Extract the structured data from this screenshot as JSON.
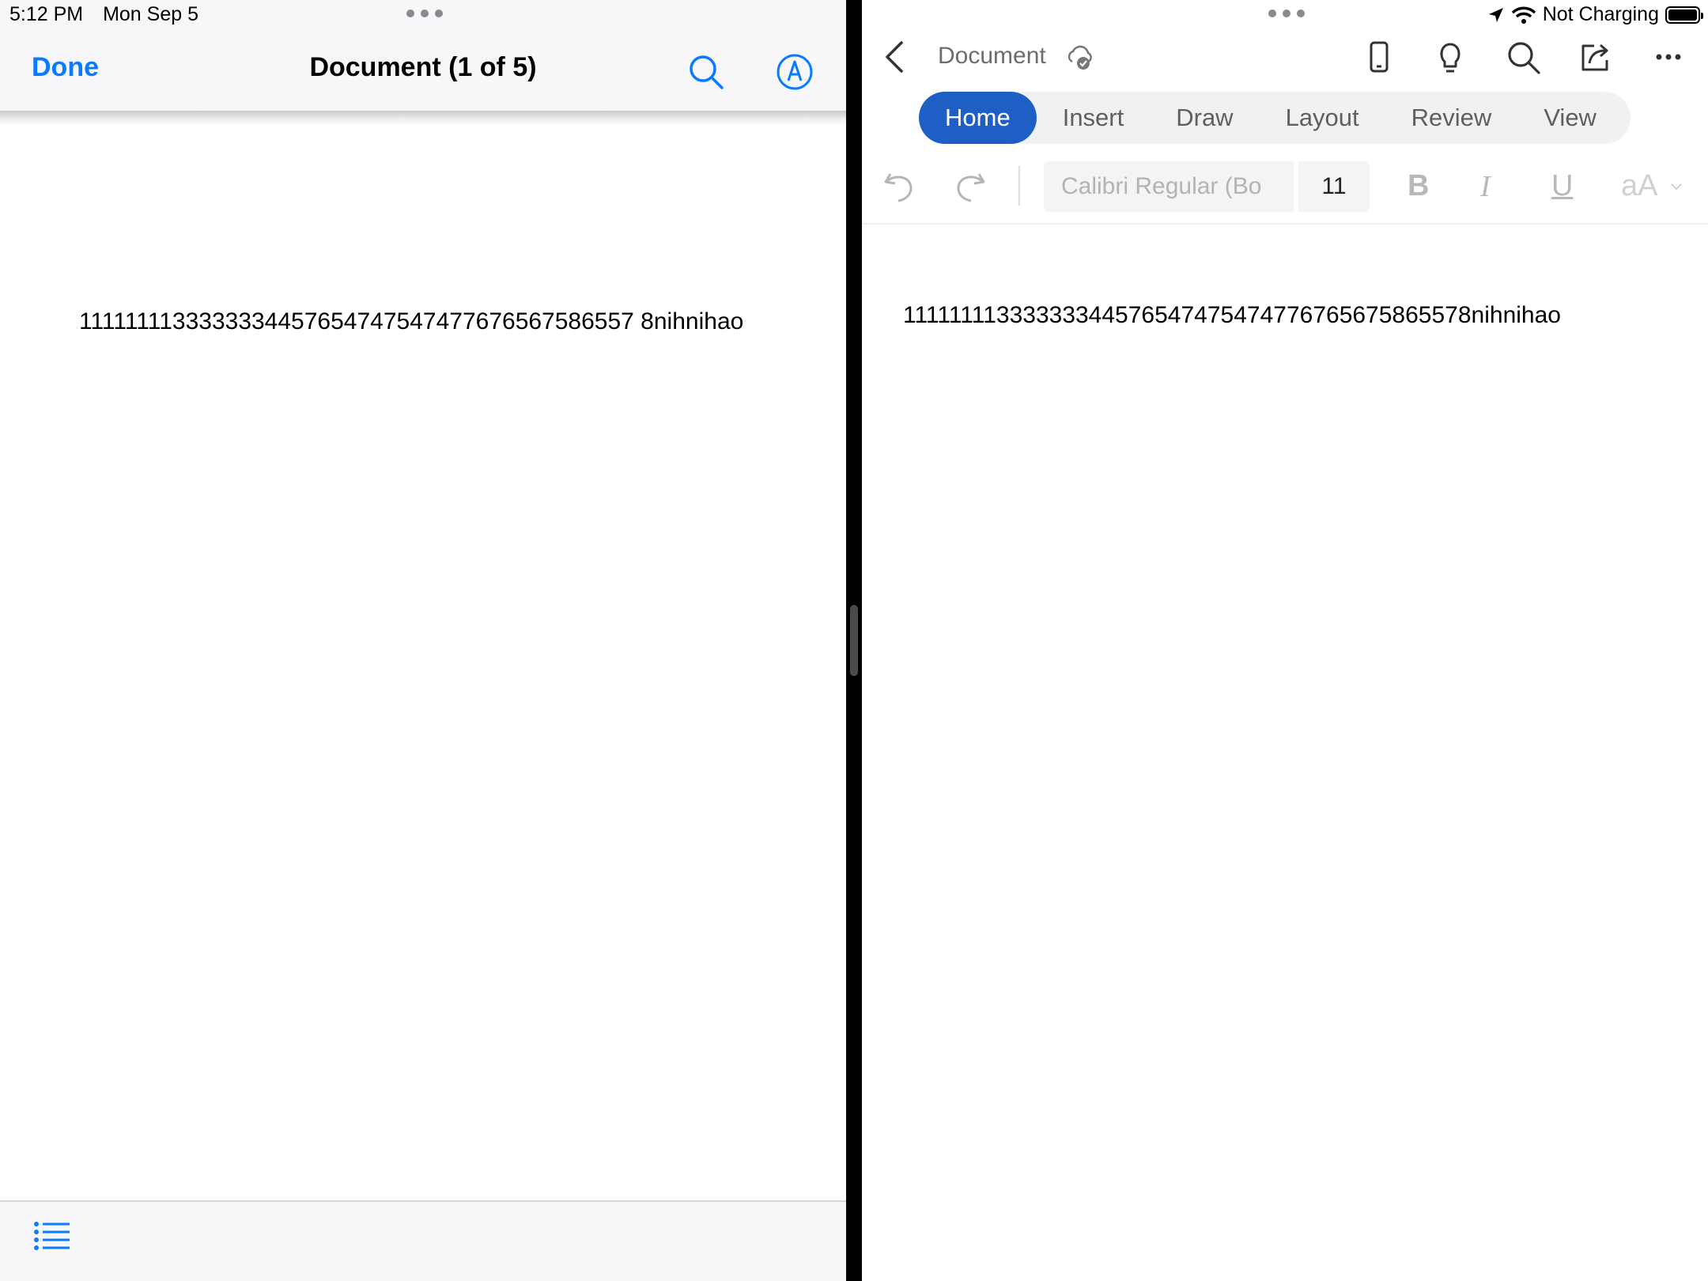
{
  "status_bar": {
    "time": "5:12 PM",
    "date": "Mon Sep 5",
    "battery_text": "Not Charging"
  },
  "preview_pane": {
    "done_label": "Done",
    "title": "Document (1 of 5)",
    "body_text": "1111111133333334457654747547477676567586557 8nihnihao"
  },
  "word_pane": {
    "document_name": "Document",
    "tabs": [
      {
        "label": "Home"
      },
      {
        "label": "Insert"
      },
      {
        "label": "Draw"
      },
      {
        "label": "Layout"
      },
      {
        "label": "Review"
      },
      {
        "label": "View"
      }
    ],
    "font_name": "Calibri Regular (Bo",
    "font_size": "11",
    "bold_label": "B",
    "italic_label": "I",
    "underline_label": "U",
    "text_size_label": "aA",
    "body_text": "11111111333333344576547475474776765675865578nihnihao"
  },
  "colors": {
    "accent_blue": "#0a7aff",
    "word_blue": "#1d5fc4"
  }
}
